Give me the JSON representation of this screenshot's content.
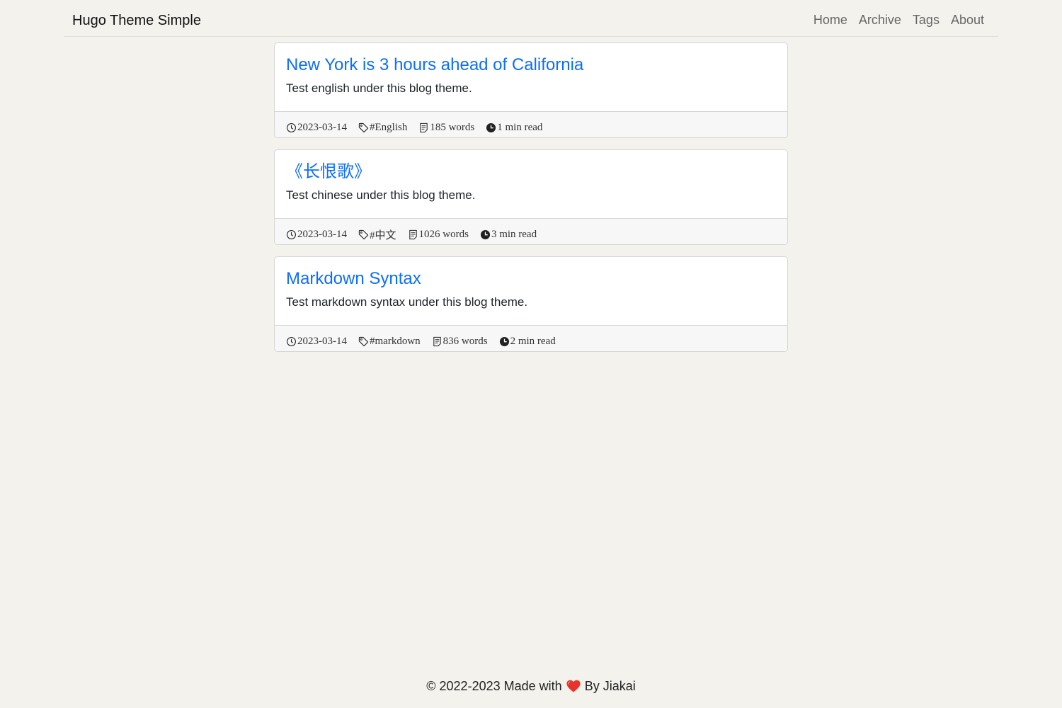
{
  "site": {
    "title": "Hugo Theme Simple"
  },
  "nav": [
    {
      "label": "Home"
    },
    {
      "label": "Archive"
    },
    {
      "label": "Tags"
    },
    {
      "label": "About"
    }
  ],
  "posts": [
    {
      "title": "New York is 3 hours ahead of California",
      "summary": "Test english under this blog theme.",
      "date": "2023-03-14",
      "tag": "#English",
      "words": "185 words",
      "read_time": "1 min read"
    },
    {
      "title": "《长恨歌》",
      "summary": "Test chinese under this blog theme.",
      "date": "2023-03-14",
      "tag": "#中文",
      "words": "1026 words",
      "read_time": "3 min read"
    },
    {
      "title": "Markdown Syntax",
      "summary": "Test markdown syntax under this blog theme.",
      "date": "2023-03-14",
      "tag": "#markdown",
      "words": "836 words",
      "read_time": "2 min read"
    }
  ],
  "footer": {
    "prefix": "© 2022-2023 Made with",
    "suffix": "By Jiakai",
    "heart_icon": "red-heart-icon"
  },
  "colors": {
    "background": "#f3f2ec",
    "link": "#0d6efd",
    "card_border": "#d6d6d6",
    "footer_bg": "#f7f7f7"
  }
}
